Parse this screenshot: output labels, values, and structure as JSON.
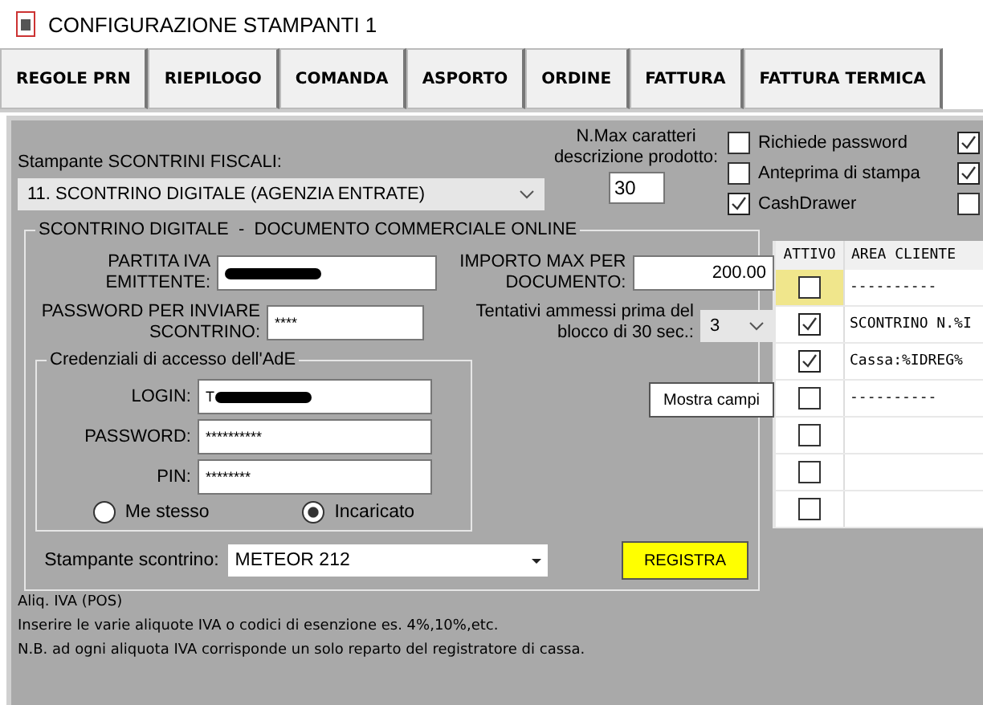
{
  "window": {
    "title": "CONFIGURAZIONE STAMPANTI 1"
  },
  "tabs": [
    "REGOLE PRN",
    "RIEPILOGO",
    "COMANDA",
    "ASPORTO",
    "ORDINE",
    "FATTURA",
    "FATTURA TERMICA"
  ],
  "printer_select": {
    "label": "Stampante SCONTRINI FISCALI:",
    "value": "11. SCONTRINO DIGITALE (AGENZIA ENTRATE)"
  },
  "max_chars": {
    "label": "N.Max caratteri descrizione prodotto:",
    "value": "30"
  },
  "options": [
    {
      "label": "Richiede password",
      "checked": false
    },
    {
      "label": "Anteprima di stampa",
      "checked": false
    },
    {
      "label": "CashDrawer",
      "checked": true
    }
  ],
  "options_column_2": [
    {
      "checked": true
    },
    {
      "checked": true
    },
    {
      "checked": false
    }
  ],
  "group": {
    "title": "SCONTRINO DIGITALE  -  DOCUMENTO COMMERCIALE ONLINE",
    "partita_iva": {
      "label": "PARTITA IVA EMITTENTE:",
      "redacted": true
    },
    "password_scontrino": {
      "label": "PASSWORD PER INVIARE SCONTRINO:",
      "value": "****"
    },
    "importo_max": {
      "label": "IMPORTO MAX PER DOCUMENTO:",
      "value": "200.00"
    },
    "tentativi": {
      "label": "Tentativi ammessi prima del blocco di 30 sec.:",
      "value": "3"
    },
    "credentials": {
      "title": "Credenziali di accesso dell'AdE",
      "login": {
        "label": "LOGIN:",
        "value": "T",
        "redacted": true
      },
      "password": {
        "label": "PASSWORD:",
        "value": "**********"
      },
      "pin": {
        "label": "PIN:",
        "value": "********"
      },
      "radios": [
        {
          "label": "Me stesso",
          "selected": false
        },
        {
          "label": "Incaricato",
          "selected": true
        }
      ]
    },
    "show_fields_button": "Mostra campi",
    "receipt_printer": {
      "label": "Stampante scontrino:",
      "value": "METEOR 212"
    },
    "register_button": "REGISTRA"
  },
  "notes": [
    "Aliq. IVA (POS)",
    "Inserire le varie aliquote IVA o codici di esenzione es. 4%,10%,etc.",
    "N.B. ad ogni aliquota IVA corrisponde un solo reparto del registratore di cassa."
  ],
  "table": {
    "columns": [
      "ATTIVO",
      "AREA CLIENTE"
    ],
    "rows": [
      {
        "active": false,
        "text": "----------",
        "selected": true
      },
      {
        "active": true,
        "text": "SCONTRINO N.%I",
        "selected": false
      },
      {
        "active": true,
        "text": "Cassa:%IDREG%",
        "selected": false
      },
      {
        "active": false,
        "text": "----------",
        "selected": false
      },
      {
        "active": false,
        "selected": false
      },
      {
        "active": false,
        "selected": false
      },
      {
        "active": false,
        "selected": false
      }
    ]
  }
}
